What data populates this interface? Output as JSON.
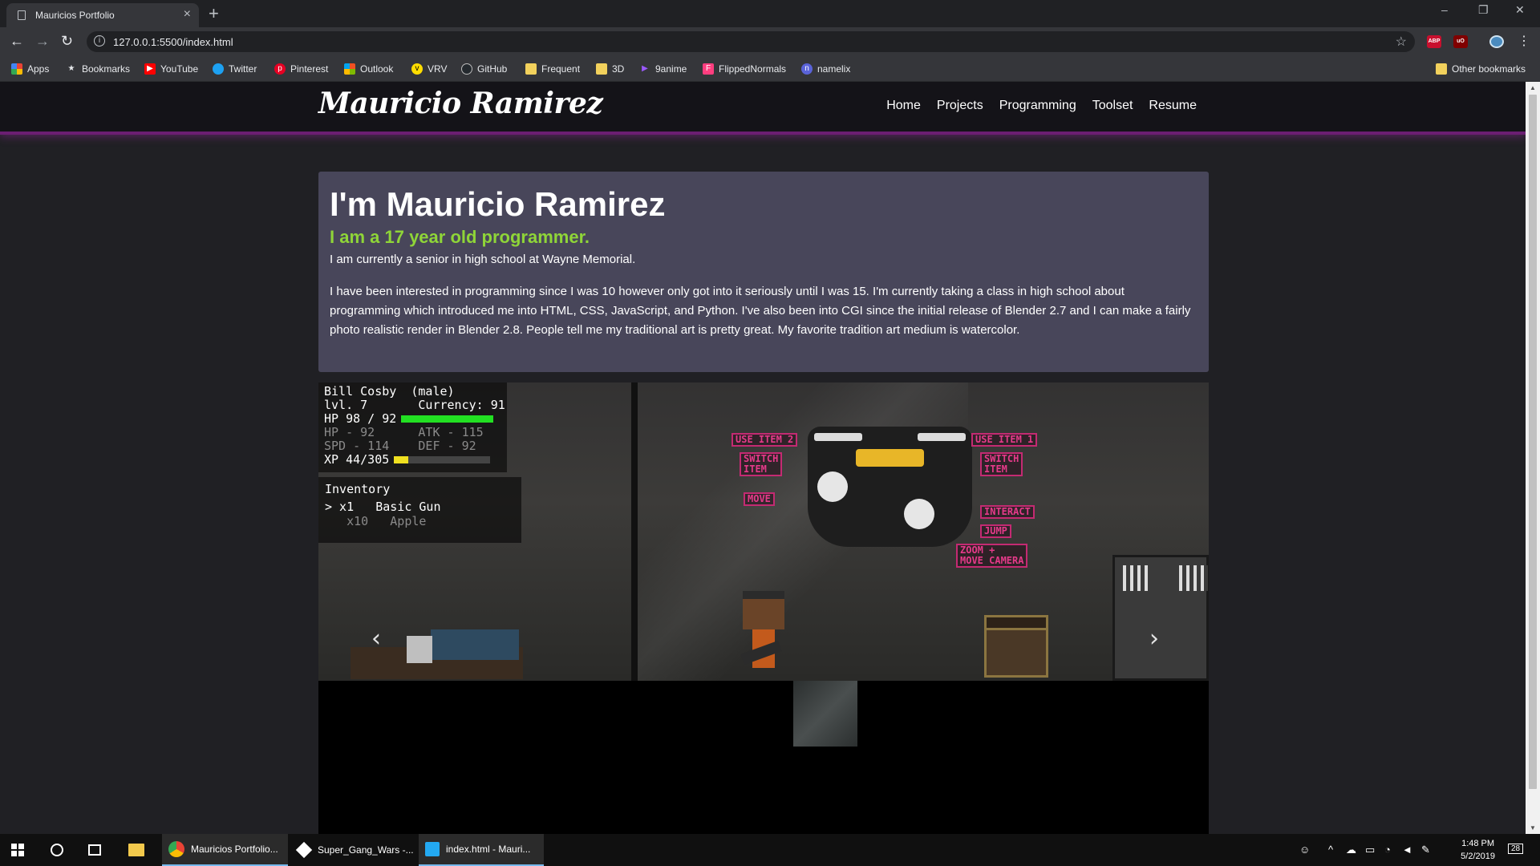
{
  "browser": {
    "tab_title": "Mauricios Portfolio",
    "tab_close": "×",
    "new_tab": "+",
    "url": "127.0.0.1:5500/index.html",
    "window_controls": [
      "–",
      "❐",
      "✕"
    ]
  },
  "bookmarks": {
    "items": [
      {
        "label": "Apps",
        "icon": "apps-grid-icon"
      },
      {
        "label": "Bookmarks",
        "icon": "star-icon"
      },
      {
        "label": "YouTube",
        "icon": "youtube-icon"
      },
      {
        "label": "Twitter",
        "icon": "twitter-icon"
      },
      {
        "label": "Pinterest",
        "icon": "pinterest-icon"
      },
      {
        "label": "Outlook",
        "icon": "outlook-icon"
      },
      {
        "label": "VRV",
        "icon": "vrv-icon"
      },
      {
        "label": "GitHub",
        "icon": "github-icon"
      },
      {
        "label": "Frequent",
        "icon": "folder-icon"
      },
      {
        "label": "3D",
        "icon": "folder-icon"
      },
      {
        "label": "9anime",
        "icon": "play-icon"
      },
      {
        "label": "FlippedNormals",
        "icon": "flippednormals-icon"
      },
      {
        "label": "namelix",
        "icon": "namelix-icon"
      }
    ],
    "other": "Other bookmarks"
  },
  "site": {
    "brand": "Mauricio Ramirez",
    "nav": [
      "Home",
      "Projects",
      "Programming",
      "Toolset",
      "Resume"
    ],
    "intro": {
      "heading": "I'm Mauricio Ramirez",
      "subheading": "I am a 17 year old programmer.",
      "para1": "I am currently a senior in high school at Wayne Memorial.",
      "para2": "I have been interested in programming since I was 10 however only got into it seriously until I was 15. I'm currently taking a class in high school about programming which introduced me into HTML, CSS, JavaScript, and Python. I've also been into CGI since the initial release of Blender 2.7 and I can make a fairly photo realistic render in Blender 2.8. People tell me my traditional art is pretty great. My favorite tradition art medium is watercolor."
    },
    "carousel": {
      "prev": "‹",
      "next": "›",
      "hud": {
        "line1": "Bill Cosby  (male)",
        "line2": "lvl. 7       Currency: 91",
        "hp_text": "HP 98 / 92",
        "hp_fill": 1.0,
        "line4": "HP - 92      ATK - 115",
        "line5": "SPD - 114    DEF - 92",
        "xp_text": "XP 44/305",
        "xp_fill": 0.144
      },
      "inventory": {
        "title": "Inventory",
        "item1": "> x1   Basic Gun",
        "item2": "   x10   Apple"
      },
      "controls": {
        "use_item_2": "USE ITEM 2",
        "use_item_1": "USE ITEM 1",
        "switch_item_l": "SWITCH\nITEM",
        "switch_item_r": "SWITCH\nITEM",
        "move": "MOVE",
        "interact": "INTERACT",
        "jump": "JUMP",
        "zoom": "ZOOM +\nMOVE CAMERA"
      }
    }
  },
  "taskbar": {
    "apps": [
      {
        "label": "Mauricios Portfolio...",
        "icon": "chrome-icon"
      },
      {
        "label": "Super_Gang_Wars -...",
        "icon": "unity-icon"
      },
      {
        "label": "index.html - Mauri...",
        "icon": "vscode-icon"
      }
    ],
    "time": "1:48 PM",
    "date": "5/2/2019",
    "notifications": "28"
  },
  "colors": {
    "accent_purple": "#6b1e72",
    "intro_bg": "#48465a",
    "subheading_green": "#8fd538",
    "hp_green": "#22e022",
    "xp_yellow": "#f0e020",
    "control_pink": "#e63a8a"
  }
}
